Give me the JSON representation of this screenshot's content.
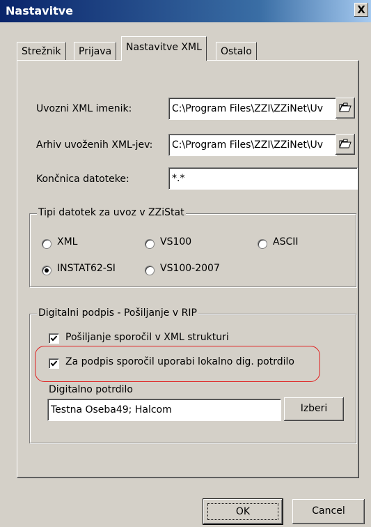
{
  "window": {
    "title": "Nastavitve",
    "close": "X"
  },
  "tabs": [
    {
      "label": "Strežnik"
    },
    {
      "label": "Prijava"
    },
    {
      "label": "Nastavitve XML"
    },
    {
      "label": "Ostalo"
    }
  ],
  "fields": {
    "import_dir_label": "Uvozni XML imenik:",
    "import_dir_value": "C:\\Program Files\\ZZI\\ZZiNet\\Uv",
    "archive_label": "Arhiv uvoženih XML-jev:",
    "archive_value": "C:\\Program Files\\ZZI\\ZZiNet\\Uv",
    "extension_label": "Končnica datoteke:",
    "extension_value": "*.*"
  },
  "file_types": {
    "title": "Tipi datotek za uvoz v ZZiStat",
    "options": [
      "XML",
      "VS100",
      "ASCII",
      "INSTAT62-SI",
      "VS100-2007"
    ],
    "selected": "INSTAT62-SI"
  },
  "signature": {
    "title": "Digitalni podpis - Pošiljanje v RIP",
    "xml_send_label": "Pošiljanje sporočil v XML strukturi",
    "xml_send_checked": true,
    "local_cert_label": "Za podpis sporočil uporabi lokalno dig. potrdilo",
    "local_cert_checked": true,
    "cert_label": "Digitalno potrdilo",
    "cert_value": "Testna Oseba49; Halcom",
    "choose_label": "Izberi"
  },
  "buttons": {
    "ok": "OK",
    "cancel": "Cancel"
  },
  "colors": {
    "highlight": "#e02020",
    "titlebar": "#0a246a",
    "dialog": "#d4d0c8"
  }
}
